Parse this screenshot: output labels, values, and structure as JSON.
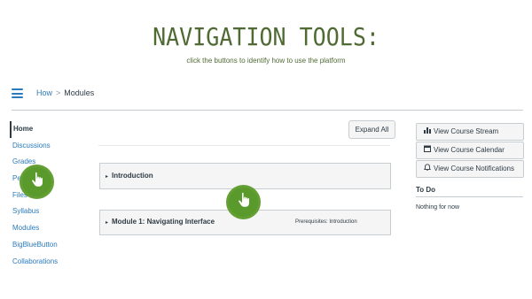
{
  "slide": {
    "title": "NAVIGATION TOOLS:",
    "subtitle": "click the buttons to identify how to use the platform"
  },
  "header": {
    "breadcrumb": [
      "How",
      "Modules"
    ],
    "separator": ">"
  },
  "course_nav": {
    "items": [
      {
        "label": "Home",
        "active": true
      },
      {
        "label": "Discussions"
      },
      {
        "label": "Grades"
      },
      {
        "label": "People"
      },
      {
        "label": "Files"
      },
      {
        "label": "Syllabus"
      },
      {
        "label": "Modules"
      },
      {
        "label": "BigBlueButton"
      },
      {
        "label": "Collaborations"
      }
    ]
  },
  "main": {
    "expand_all": "Expand All",
    "modules": [
      {
        "title": "Introduction",
        "caret": "▸"
      },
      {
        "title": "Module 1: Navigating Interface",
        "caret": "▸",
        "prerequisites": "Prerequisites: Introduction"
      }
    ]
  },
  "sidebar": {
    "buttons": [
      {
        "label": "View Course Stream",
        "icon": "bar-chart-icon"
      },
      {
        "label": "View Course Calendar",
        "icon": "calendar-icon"
      },
      {
        "label": "View Course Notifications",
        "icon": "bell-icon"
      }
    ],
    "todo_title": "To Do",
    "todo_empty": "Nothing for now"
  },
  "colors": {
    "link": "#2b7abc",
    "title_green": "#4f6b33",
    "hotspot_green": "#5a9a2c",
    "text": "#2d3b45"
  },
  "hotspots": [
    {
      "icon": "pointer-hand-icon"
    },
    {
      "icon": "pointer-hand-icon"
    }
  ]
}
